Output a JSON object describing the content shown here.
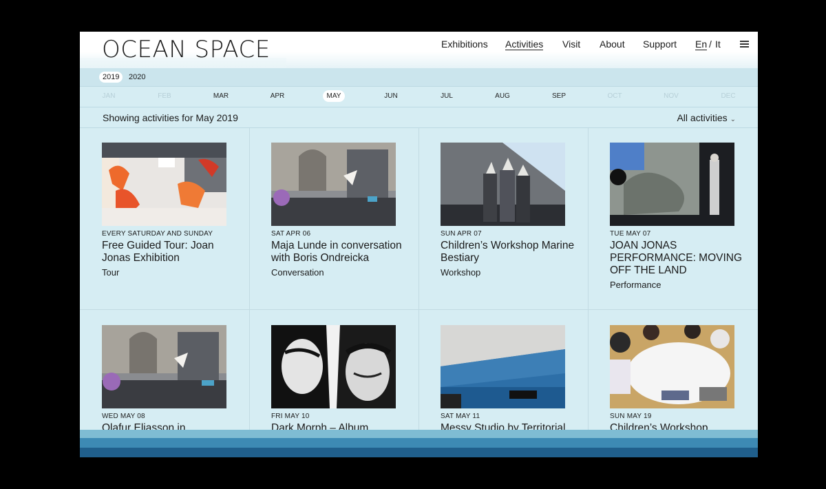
{
  "header": {
    "logo": "OCEAN SPACE",
    "nav": [
      "Exhibitions",
      "Activities",
      "Visit",
      "About",
      "Support"
    ],
    "lang_en": "En",
    "lang_sep": "/",
    "lang_it": "It",
    "menu_icon": "hamburger-icon"
  },
  "years": [
    "2019",
    "2020"
  ],
  "selected_year": "2019",
  "months": [
    "JAN",
    "FEB",
    "MAR",
    "APR",
    "MAY",
    "JUN",
    "JUL",
    "AUG",
    "SEP",
    "OCT",
    "NOV",
    "DEC"
  ],
  "selected_month": "MAY",
  "disabled_months": [
    "JAN",
    "FEB",
    "OCT",
    "NOV",
    "DEC"
  ],
  "showing_text": "Showing activities for May 2019",
  "filter_label": "All activities",
  "activities": [
    {
      "date": "EVERY SATURDAY AND SUNDAY",
      "title": "Free Guided Tour: Joan Jonas Exhibition",
      "type": "Tour"
    },
    {
      "date": "SAT APR 06",
      "title": "Maja Lunde in conversation with Boris Ondreicka",
      "type": "Conversation"
    },
    {
      "date": "SUN APR 07",
      "title": "Children’s Workshop Marine Bestiary",
      "type": "Workshop"
    },
    {
      "date": "TUE MAY 07",
      "title": "JOAN JONAS PERFORMANCE: MOVING OFF THE LAND",
      "type": "Performance"
    },
    {
      "date": "WED MAY 08",
      "title": "Olafur Eliasson in",
      "type": ""
    },
    {
      "date": "FRI MAY 10",
      "title": "Dark Morph – Album Release",
      "type": ""
    },
    {
      "date": "SAT MAY 11",
      "title": "Messy Studio by Territorial",
      "type": ""
    },
    {
      "date": "SUN MAY 19",
      "title": "Children’s Workshop",
      "type": ""
    }
  ],
  "colors": {
    "page_bg": "#d6edf3",
    "wave_light": "#7fbcd3",
    "wave_mid": "#3d8ab4",
    "wave_dark": "#205f8c"
  }
}
